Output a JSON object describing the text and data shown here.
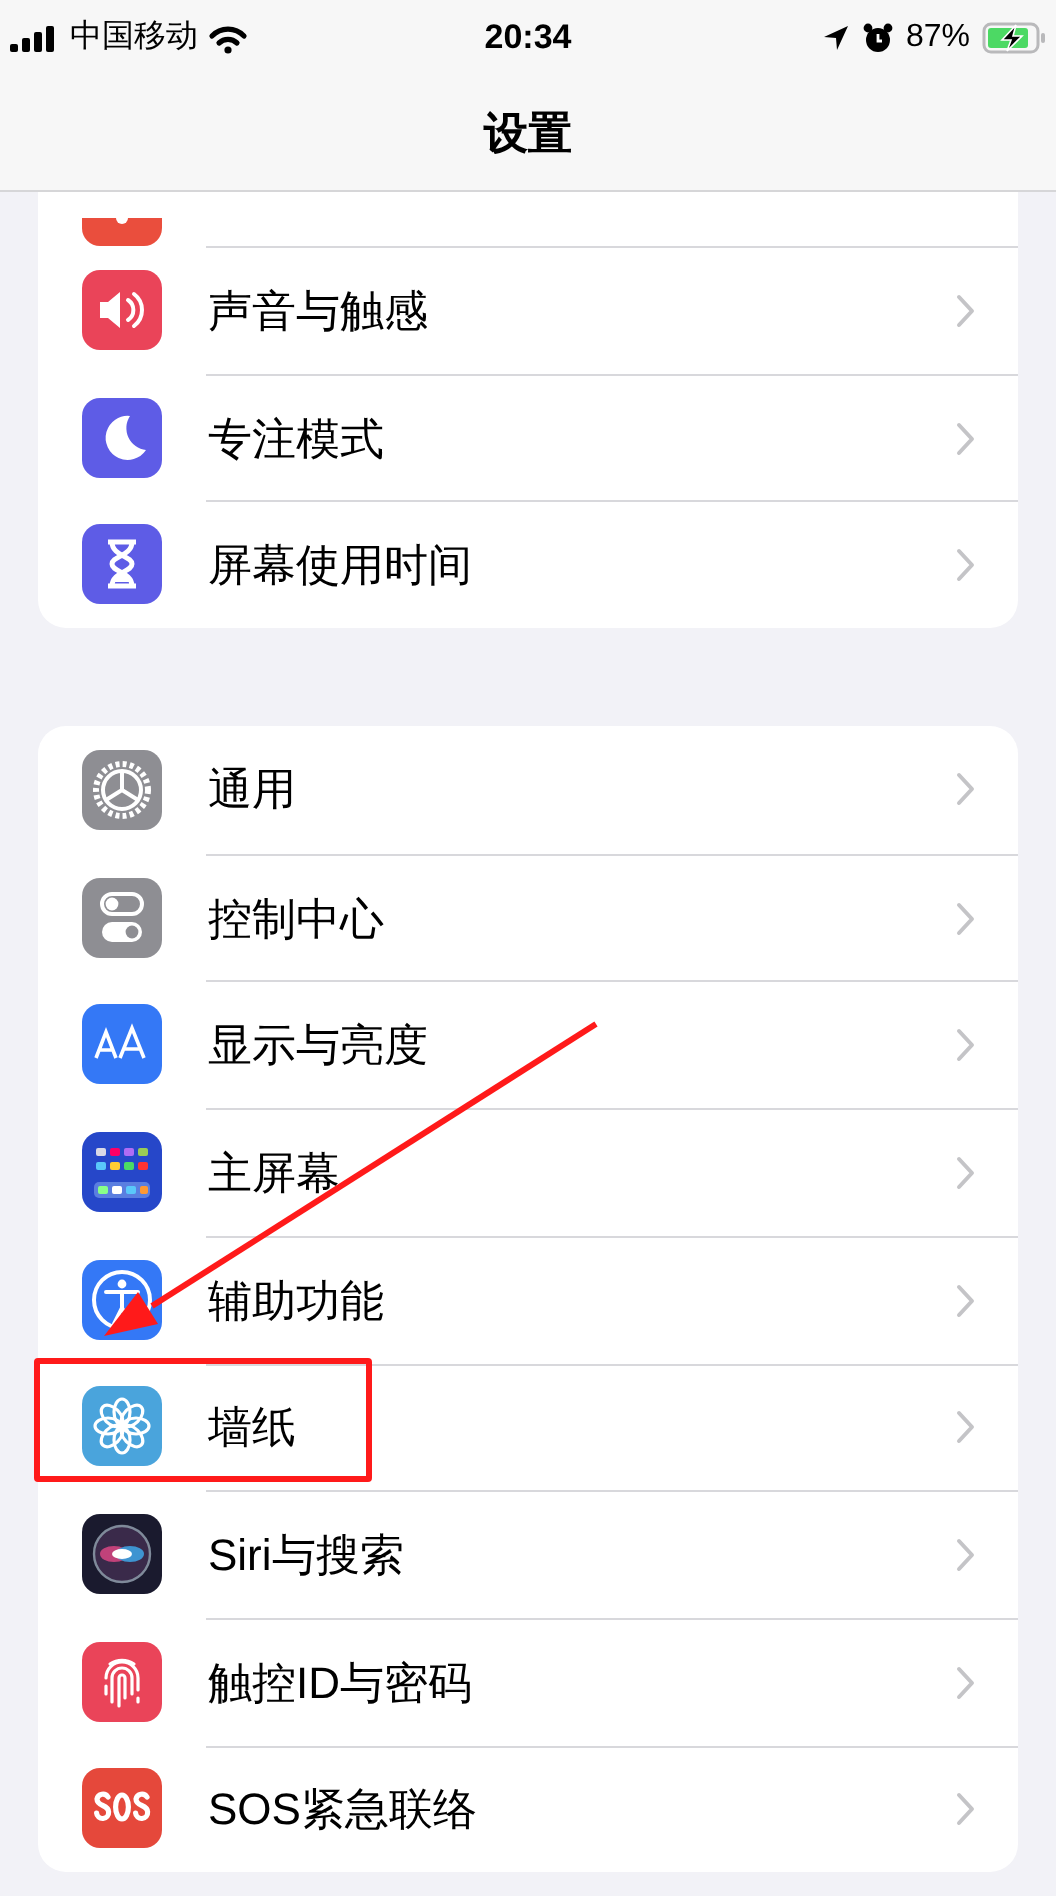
{
  "status_bar": {
    "carrier": "中国移动",
    "time": "20:34",
    "battery": "87%"
  },
  "nav": {
    "title": "设置"
  },
  "groups": [
    {
      "rows": [
        {
          "label": "声音与触感",
          "highlighted": false
        },
        {
          "label": "专注模式",
          "highlighted": false
        },
        {
          "label": "屏幕使用时间",
          "highlighted": false
        }
      ]
    },
    {
      "rows": [
        {
          "label": "通用",
          "highlighted": false
        },
        {
          "label": "控制中心",
          "highlighted": false
        },
        {
          "label": "显示与亮度",
          "highlighted": false
        },
        {
          "label": "主屏幕",
          "highlighted": false
        },
        {
          "label": "辅助功能",
          "highlighted": false
        },
        {
          "label": "墙纸",
          "highlighted": true
        },
        {
          "label": "Siri与搜索",
          "highlighted": false
        },
        {
          "label": "触控ID与密码",
          "highlighted": false
        },
        {
          "label": "SOS紧急联络",
          "highlighted": false
        }
      ]
    }
  ]
}
